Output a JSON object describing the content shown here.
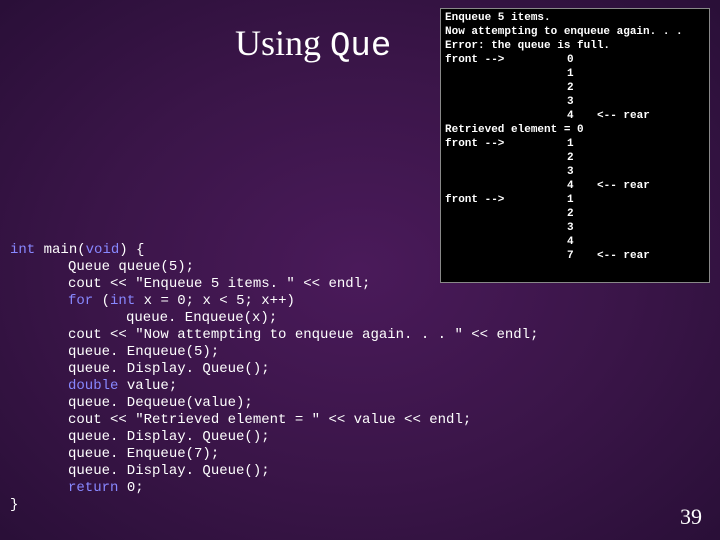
{
  "title": {
    "part1": "Using ",
    "part2": "Que",
    "hidden_rest": "ue"
  },
  "code": {
    "l1a": "int",
    "l1b": " main(",
    "l1c": "void",
    "l1d": ") {",
    "l2": "Queue queue(5);",
    "l3": "cout << \"Enqueue 5 items. \" << endl;",
    "l4a": "for",
    "l4b": " (",
    "l4c": "int",
    "l4d": " x = 0; x < 5; x++)",
    "l5": "queue. Enqueue(x);",
    "l6": "cout << \"Now attempting to enqueue again. . . \" << endl;",
    "l7": "queue. Enqueue(5);",
    "l8": "queue. Display. Queue();",
    "l9a": "double",
    "l9b": " value;",
    "l10": "queue. Dequeue(value);",
    "l11": "cout << \"Retrieved element = \" << value << endl;",
    "l12": "queue. Display. Queue();",
    "l13": "queue. Enqueue(7);",
    "l14": "queue. Display. Queue();",
    "l15a": "return",
    "l15b": " 0;",
    "l16": "}"
  },
  "console": {
    "rows": [
      {
        "left": "Enqueue 5 items.",
        "mid": "",
        "right": ""
      },
      {
        "left": "Now attempting to enqueue again. . .",
        "mid": "",
        "right": ""
      },
      {
        "left": "Error: the queue is full.",
        "mid": "",
        "right": ""
      },
      {
        "left": "front -->",
        "mid": "0",
        "right": ""
      },
      {
        "left": "",
        "mid": "1",
        "right": ""
      },
      {
        "left": "",
        "mid": "2",
        "right": ""
      },
      {
        "left": "",
        "mid": "3",
        "right": ""
      },
      {
        "left": "",
        "mid": "4",
        "right": "<-- rear"
      },
      {
        "left": "Retrieved element = 0",
        "mid": "",
        "right": ""
      },
      {
        "left": "front -->",
        "mid": "1",
        "right": ""
      },
      {
        "left": "",
        "mid": "2",
        "right": ""
      },
      {
        "left": "",
        "mid": "3",
        "right": ""
      },
      {
        "left": "",
        "mid": "4",
        "right": "<-- rear"
      },
      {
        "left": "front -->",
        "mid": "1",
        "right": ""
      },
      {
        "left": "",
        "mid": "2",
        "right": ""
      },
      {
        "left": "",
        "mid": "3",
        "right": ""
      },
      {
        "left": "",
        "mid": "4",
        "right": ""
      },
      {
        "left": "",
        "mid": "7",
        "right": "<-- rear"
      }
    ]
  },
  "slidenum": "39"
}
